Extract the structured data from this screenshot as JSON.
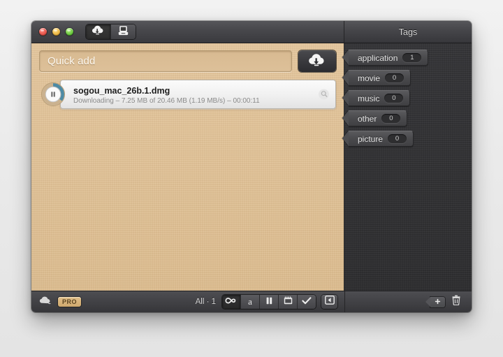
{
  "window": {
    "titlebar": {
      "traffic_lights": [
        {
          "name": "close",
          "color": "#e24b41"
        },
        {
          "name": "minimize",
          "color": "#e9ae36"
        },
        {
          "name": "zoom",
          "color": "#5cc034"
        }
      ],
      "segments": [
        {
          "icon": "cloud-download-icon",
          "label": "Downloads",
          "active": true
        },
        {
          "icon": "dropbox-tray-icon",
          "label": "Drop Box",
          "active": false
        }
      ],
      "search_icon": "search-icon",
      "tags_panel_title": "Tags"
    },
    "quick_add": {
      "placeholder": "Quick add",
      "value": "",
      "download_button_icon": "cloud-download-icon",
      "download_button_label": "Download"
    },
    "downloads": [
      {
        "name": "sogou_mac_26b.1.dmg",
        "status": "Downloading – 7.25 MB of 20.46 MB (1.19 MB/s) – 00:00:11",
        "progress_percent": 35,
        "action_icon": "pause-icon",
        "reveal_icon": "magnifier-icon",
        "progress_color": "#4d8ba5"
      }
    ],
    "tags": [
      {
        "label": "application",
        "count": "1"
      },
      {
        "label": "movie",
        "count": "0"
      },
      {
        "label": "music",
        "count": "0"
      },
      {
        "label": "other",
        "count": "0"
      },
      {
        "label": "picture",
        "count": "0"
      }
    ],
    "bottom_bar": {
      "cloud_icon": "cloud-icon",
      "pro_badge": "PRO",
      "count_label": "All · 1",
      "filters": [
        {
          "icon": "infinity-icon",
          "label": "All",
          "active": true
        },
        {
          "icon": "letter-a-icon",
          "label": "Active",
          "active": false
        },
        {
          "icon": "pause-icon",
          "label": "Paused",
          "active": false
        },
        {
          "icon": "calendar-icon",
          "label": "Scheduled",
          "active": false
        },
        {
          "icon": "checkmark-icon",
          "label": "Completed",
          "active": false
        }
      ],
      "panel_toggle_icon": "sidebar-toggle-icon",
      "add_tag_icon": "add-tag-icon",
      "delete_tag_icon": "trash-icon"
    }
  },
  "colors": {
    "content_bg": "#e0c197",
    "panel_bg": "#333335",
    "chrome": "#45454a",
    "pro_badge": "#d8b57c",
    "progress": "#4d8ba5"
  }
}
